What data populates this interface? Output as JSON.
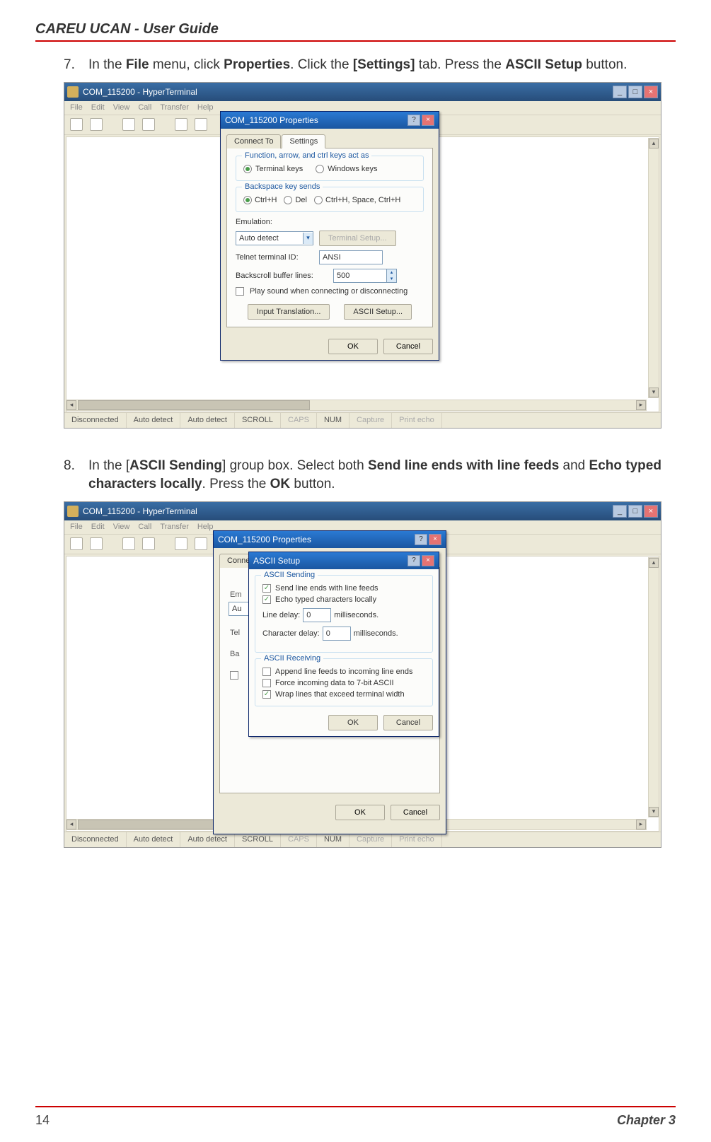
{
  "header": "CAREU UCAN -  User Guide",
  "steps": {
    "s7": {
      "num": "7.",
      "pre": "In the ",
      "file": "File",
      "mid1": " menu, click ",
      "props": "Properties",
      "mid2": ". Click the ",
      "settings": "[Settings]",
      "mid3": " tab. Press the ",
      "ascii": "ASCII Setup",
      "post": " button."
    },
    "s8": {
      "num": "8.",
      "pre": "In the [",
      "ascii_sending": "ASCII Sending",
      "mid1": "] group box. Select both ",
      "send": "Send line ends with line feeds",
      "mid2": " and ",
      "echo": "Echo typed characters locally",
      "mid3": ". Press the ",
      "ok": "OK",
      "post": " button."
    }
  },
  "window": {
    "title": "COM_115200 - HyperTerminal",
    "menus": [
      "File",
      "Edit",
      "View",
      "Call",
      "Transfer",
      "Help"
    ]
  },
  "status": {
    "conn": "Disconnected",
    "auto1": "Auto detect",
    "auto2": "Auto detect",
    "scroll": "SCROLL",
    "caps": "CAPS",
    "num": "NUM",
    "capture": "Capture",
    "echo": "Print echo"
  },
  "propsDialog": {
    "title": "COM_115200 Properties",
    "tab_connect": "Connect To",
    "tab_settings": "Settings",
    "group_fn": "Function, arrow, and ctrl keys act as",
    "terminal_keys": "Terminal keys",
    "windows_keys": "Windows keys",
    "group_bksp": "Backspace key sends",
    "ctrlh": "Ctrl+H",
    "del": "Del",
    "ctrlh_space": "Ctrl+H, Space, Ctrl+H",
    "emulation": "Emulation:",
    "auto_detect": "Auto detect",
    "terminal_setup": "Terminal Setup...",
    "telnet_id": "Telnet terminal ID:",
    "ansi": "ANSI",
    "backscroll": "Backscroll buffer lines:",
    "backscroll_val": "500",
    "play_sound": "Play sound when connecting or disconnecting",
    "input_trans": "Input Translation...",
    "ascii_setup": "ASCII Setup...",
    "ok": "OK",
    "cancel": "Cancel"
  },
  "asciiDialog": {
    "title": "ASCII Setup",
    "group_send": "ASCII Sending",
    "send_line": "Send line ends with line feeds",
    "echo_typed": "Echo typed characters locally",
    "line_delay": "Line delay:",
    "line_delay_val": "0",
    "ms": "milliseconds.",
    "char_delay": "Character delay:",
    "char_delay_val": "0",
    "group_recv": "ASCII Receiving",
    "append": "Append line feeds to incoming line ends",
    "force7": "Force incoming data to 7-bit ASCII",
    "wrap": "Wrap lines that exceed terminal width",
    "ok": "OK",
    "cancel": "Cancel"
  },
  "footer": {
    "pagenum": "14",
    "chapter": "Chapter 3"
  }
}
